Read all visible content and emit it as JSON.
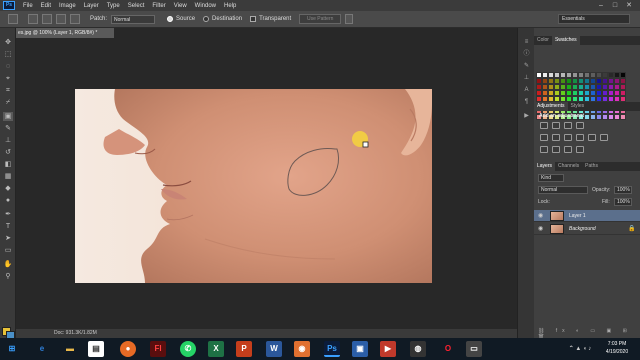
{
  "menubar": {
    "logo": "Ps",
    "items": [
      "File",
      "Edit",
      "Image",
      "Layer",
      "Type",
      "Select",
      "Filter",
      "View",
      "Window",
      "Help"
    ],
    "window_controls": [
      "–",
      "□",
      "✕"
    ]
  },
  "options": {
    "patch_label": "Patch:",
    "patch_mode": "Normal",
    "source_label": "Source",
    "destination_label": "Destination",
    "transparent_label": "Transparent",
    "use_pattern_label": "Use Pattern",
    "workspace": "Essentials"
  },
  "document": {
    "tab_title": "es.jpg @ 100% (Layer 1, RGB/8#) *",
    "status_text": "Doc: 931.3K/1.82M"
  },
  "colors": {
    "accent": "#3aa0ff",
    "foreground_swatch": "#e8c238",
    "background_swatch": "#4a90c8"
  },
  "panels": {
    "color_tabs": [
      "Color",
      "Swatches"
    ],
    "adjustment_tabs": [
      "Adjustments",
      "Styles"
    ],
    "adjustment_title": "Add an adjustment",
    "layer_tabs": [
      "Layers",
      "Channels",
      "Paths"
    ],
    "kind_label": "Kind",
    "blend_mode": "Normal",
    "opacity_label": "Opacity:",
    "opacity_value": "100%",
    "lock_label": "Lock:",
    "fill_label": "Fill:",
    "fill_value": "100%",
    "layers": [
      {
        "name": "Layer 1"
      },
      {
        "name": "Background"
      }
    ]
  },
  "taskbar": {
    "time": "7:03 PM",
    "date": "4/19/2020"
  }
}
